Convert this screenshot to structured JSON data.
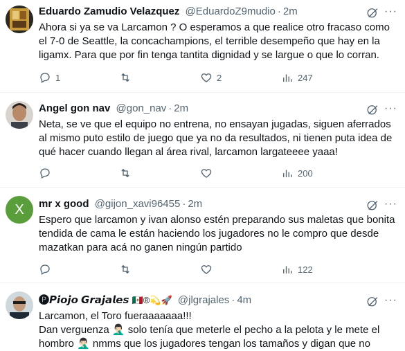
{
  "tweets": [
    {
      "name": "Eduardo Zamudio Velazquez",
      "handle": "@EduardoZ9mudio",
      "time": "2m",
      "text": "Ahora si ya se va Larcamon ? O esperamos a que realice otro fracaso como el 7-0 de Seattle, la concachampions, el terrible desempeño que hay en la ligamx. Para que por fin tenga tantita dignidad y se largue o que lo corran.",
      "replies": "1",
      "retweets": "",
      "likes": "2",
      "views": "247"
    },
    {
      "name": "Angel gon nav",
      "handle": "@gon_nav",
      "time": "2m",
      "text": "Neta, se ve que el equipo no entrena, no ensayan jugadas, siguen aferrados al mismo puto estilo de juego que ya no da resultados, ni tienen puta idea de qué hacer cuando llegan al área rival, larcamon largateeee yaaa!",
      "replies": "",
      "retweets": "",
      "likes": "",
      "views": "200"
    },
    {
      "name": "mr x good",
      "handle": "@gijon_xavi96455",
      "time": "2m",
      "avatar_letter": "X",
      "text": "Espero que larcamon y ivan alonso estén preparando sus maletas que bonita tendida de cama le están haciendo los jugadores no le compro que desde mazatkan para acá no ganen ningún partido",
      "replies": "",
      "retweets": "",
      "likes": "",
      "views": "122"
    },
    {
      "name": "🅟𝙋𝙞𝙤𝙟𝙤 𝙂𝙧𝙖𝙟𝙖𝙡𝙚𝙨",
      "name_emoji": "🇲🇽®💫🚀",
      "handle": "@jlgrajales",
      "time": "4m",
      "text_line1": "Larcamon, el Toro fueraaaaaaa!!!",
      "text_line2": "Dan verguenza 🤦🏻‍♂️ solo tenía que meterle el pecho a la pelota y le mete el",
      "text_line3": "hombro 🤦🏻‍♂️ nmms que los jugadores tengan los tamaños y digan que no"
    }
  ],
  "colors": {
    "text": "#0f1419",
    "muted": "#536471",
    "divider": "#eff3f4",
    "avatar_x": "#5a9e3c"
  }
}
